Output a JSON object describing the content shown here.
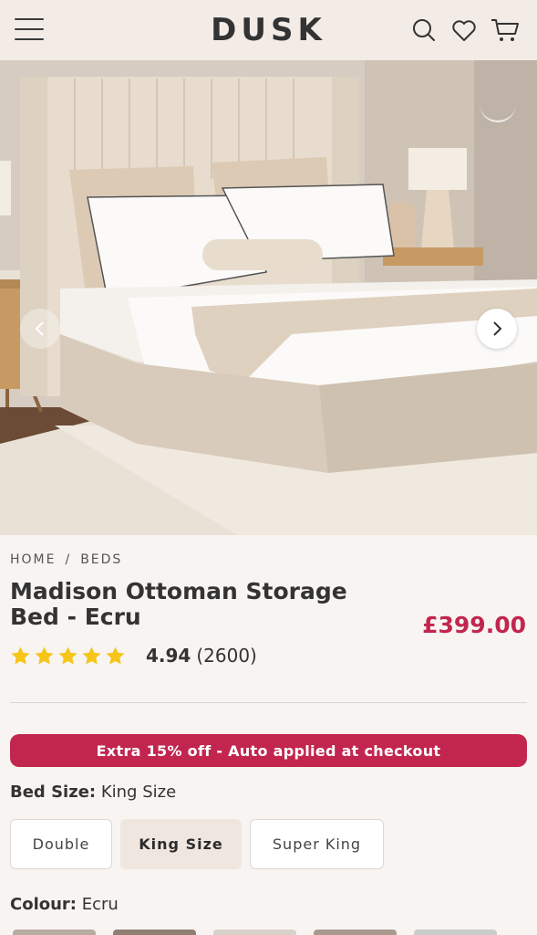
{
  "header": {
    "logo": "DUSK",
    "icons": [
      "menu-icon",
      "search-icon",
      "heart-icon",
      "cart-icon"
    ]
  },
  "gallery": {
    "image": "bed-product-photo",
    "prev_icon": "chevron-left-icon",
    "next_icon": "chevron-right-icon"
  },
  "breadcrumb": {
    "home": "HOME",
    "separator": "/",
    "category": "BEDS"
  },
  "product": {
    "title": "Madison Ottoman Storage Bed - Ecru",
    "price": "£399.00",
    "rating_score": "4.94",
    "rating_count": "(2600)",
    "rating_stars": 5
  },
  "promo": {
    "text": "Extra 15% off - Auto applied at checkout"
  },
  "bed_size": {
    "label": "Bed Size:",
    "value": "King Size",
    "options": [
      "Double",
      "King Size",
      "Super King"
    ],
    "selected": "King Size"
  },
  "colour": {
    "label": "Colour:",
    "value": "Ecru"
  },
  "colors": {
    "accent": "#c2264e",
    "header_bg": "#f3ebe6",
    "page_bg": "#f8f4f1",
    "star": "#f5c518",
    "selected_option_bg": "#efe6df"
  }
}
